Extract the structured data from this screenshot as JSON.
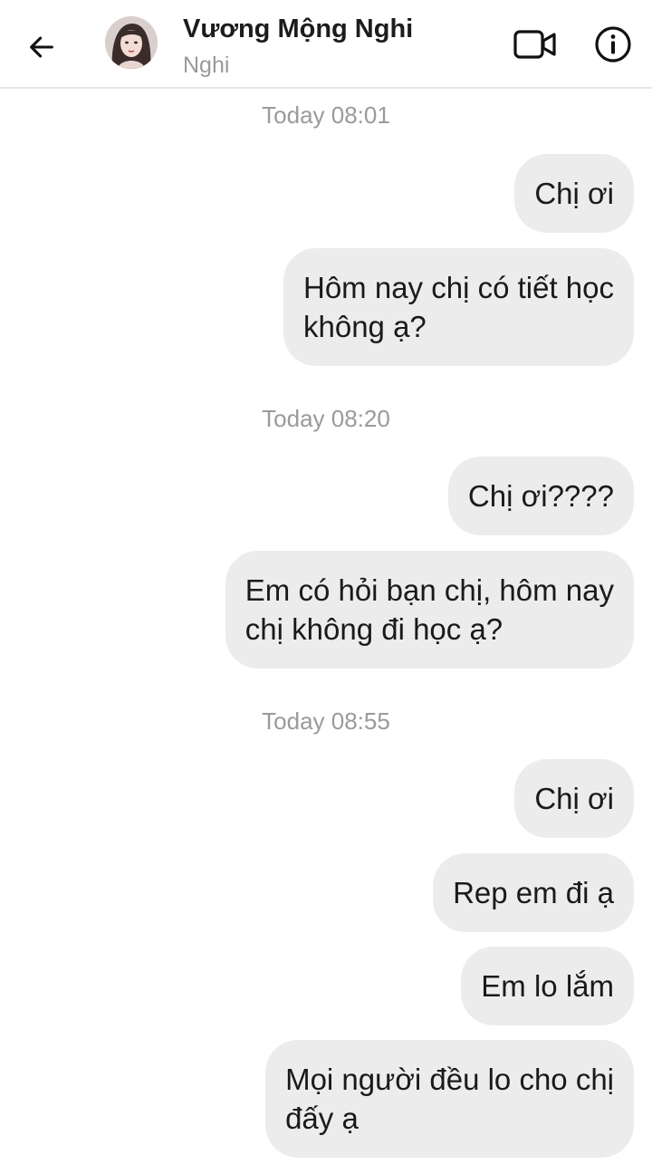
{
  "header": {
    "contact_name": "Vương Mộng Nghi",
    "contact_subtitle": "Nghi",
    "back_icon": "arrow-left-icon",
    "video_icon": "video-camera-icon",
    "info_icon": "info-circle-icon"
  },
  "conversation": [
    {
      "type": "time",
      "text": "Today 08:01"
    },
    {
      "type": "message",
      "lines": [
        "Chị ơi"
      ]
    },
    {
      "type": "message",
      "lines": [
        "Hôm nay chị có tiết học",
        "không ạ?"
      ]
    },
    {
      "type": "time",
      "text": "Today 08:20"
    },
    {
      "type": "message",
      "lines": [
        "Chị ơi????"
      ]
    },
    {
      "type": "message",
      "lines": [
        "Em có hỏi bạn chị, hôm nay",
        "chị không đi học ạ?"
      ]
    },
    {
      "type": "time",
      "text": "Today 08:55"
    },
    {
      "type": "message",
      "lines": [
        "Chị ơi"
      ]
    },
    {
      "type": "message",
      "lines": [
        "Rep em đi ạ"
      ]
    },
    {
      "type": "message",
      "lines": [
        "Em lo lắm"
      ]
    },
    {
      "type": "message",
      "lines": [
        "Mọi người đều lo cho chị",
        "đấy ạ"
      ]
    }
  ],
  "colors": {
    "bubble": "#ececec",
    "text": "#1a1a1a",
    "timestamp": "#9a9a9a"
  }
}
